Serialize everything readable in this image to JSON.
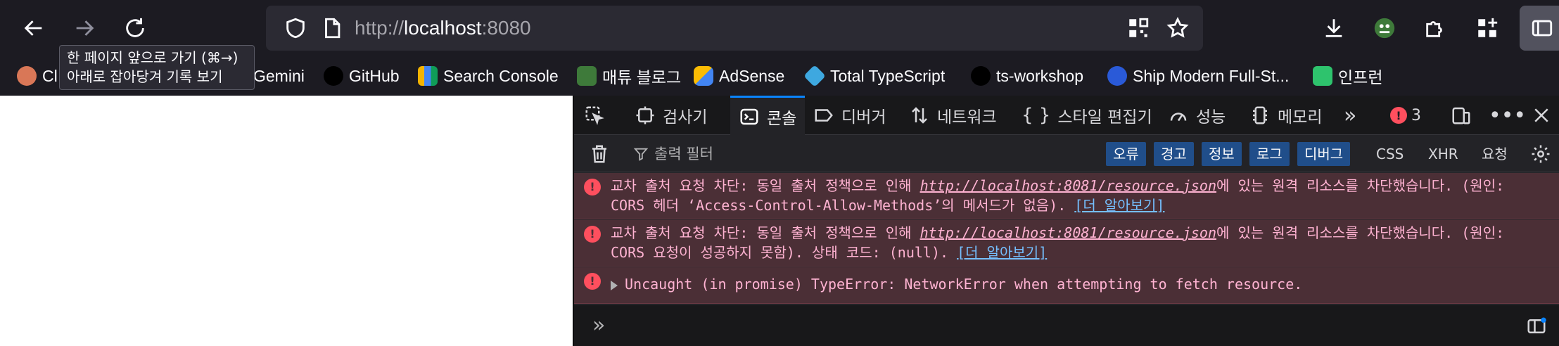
{
  "browser": {
    "url": {
      "scheme": "http://",
      "host": "localhost",
      "port": ":8080"
    },
    "tooltip": {
      "line1": "한 페이지 앞으로 가기 (⌘→)",
      "line2": "아래로 잡아당겨 기록 보기"
    },
    "icons": [
      "back-arrow-icon",
      "forward-arrow-icon",
      "reload-icon",
      "shield-icon",
      "page-icon",
      "qr-code-icon",
      "star-icon",
      "download-icon",
      "extension-avatar-icon",
      "puzzle-icon",
      "apps-icon",
      "sidebar-icon"
    ]
  },
  "bookmarks": [
    {
      "label": "Cl",
      "color": "#d97757"
    },
    {
      "label": "Gemini",
      "color": "#1c1b22"
    },
    {
      "label": "GitHub",
      "color": "#1c1b22"
    },
    {
      "label": "Search Console",
      "color": "#f4b400"
    },
    {
      "label": "매튜 블로그",
      "color": "#3e7a3a"
    },
    {
      "label": "AdSense",
      "color": "#4285f4"
    },
    {
      "label": "Total TypeScript",
      "color": "#3ea8e0"
    },
    {
      "label": "ts-workshop",
      "color": "#1c1b22"
    },
    {
      "label": "Ship Modern Full-St...",
      "color": "#2a5ad8"
    },
    {
      "label": "인프런",
      "color": "#2ec36d"
    }
  ],
  "devtools": {
    "tabs": [
      "검사기",
      "콘솔",
      "디버거",
      "네트워크",
      "스타일 편집기",
      "성능",
      "메모리"
    ],
    "active_tab": "콘솔",
    "error_count": "3",
    "filter_placeholder": "출력 필터",
    "levels": [
      "오류",
      "경고",
      "정보",
      "로그",
      "디버그"
    ],
    "net_filters": [
      "CSS",
      "XHR",
      "요청"
    ],
    "messages": [
      {
        "prefix": "교차 출처 요청 차단: 동일 출처 정책으로 인해 ",
        "link": "http://localhost:8081/resource.json",
        "suffix": "에 있는 원격 리소스를 차단했습니다. (원인: CORS 헤더 ‘Access-Control-Allow-Methods’의 메서드가 없음). ",
        "learn_more": "[더 알아보기]"
      },
      {
        "prefix": "교차 출처 요청 차단: 동일 출처 정책으로 인해 ",
        "link": "http://localhost:8081/resource.json",
        "suffix": "에 있는 원격 리소스를 차단했습니다. (원인: CORS 요청이 성공하지 못함). 상태 코드: (null). ",
        "learn_more": "[더 알아보기]"
      },
      {
        "text": "Uncaught (in promise) TypeError: NetworkError when attempting to fetch resource."
      }
    ],
    "prompt_symbol": "»"
  }
}
